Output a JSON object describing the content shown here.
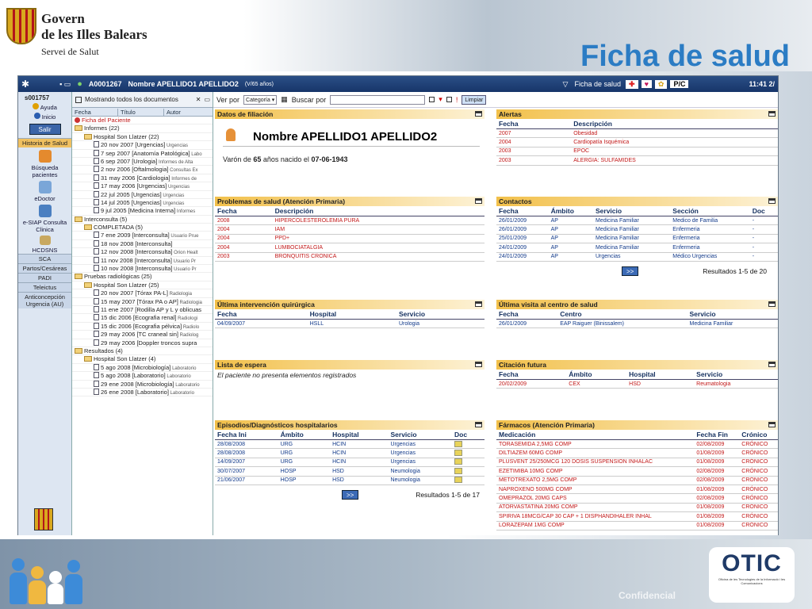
{
  "slide": {
    "org_line1": "Govern",
    "org_line2": "de les Illes Balears",
    "org_line3": "Servei de Salut",
    "title": "Ficha de salud",
    "confidential": "Confidencial",
    "otic_logo": "OTIC",
    "otic_caption": "Oficina de les Tecnologies de la Informació i les Comunicacions"
  },
  "appbar": {
    "patient_id": "A0001267",
    "patient_name": "Nombre APELLIDO1 APELLIDO2",
    "age": "(V/65 años)",
    "section": "Ficha de salud",
    "badge_pc": "P/C",
    "clock": "11:41 2/"
  },
  "leftnav": {
    "user": "s001757",
    "help": "Ayuda",
    "home": "Inicio",
    "exit": "Salir",
    "active_tab": "Historia de Salud",
    "tools": [
      "Búsqueda pacientes",
      "eDoctor",
      "e-SIAP Consulta Clinica",
      "HCDSNS"
    ],
    "tabs": [
      "SCA",
      "Partos/Cesáreas",
      "PADI",
      "Teleictus",
      "Anticoncepción Urgencia (AU)"
    ]
  },
  "tree": {
    "showing": "Mostrando todos los documentos",
    "columns": [
      "Fecha",
      "Título",
      "Autor"
    ],
    "rows": [
      {
        "indent": 0,
        "kind": "red",
        "text": "Ficha del Paciente",
        "sub": ""
      },
      {
        "indent": 0,
        "kind": "folder",
        "text": "Informes  (22)",
        "sub": ""
      },
      {
        "indent": 1,
        "kind": "folder",
        "text": "Hospital Son Llatzer  (22)",
        "sub": ""
      },
      {
        "indent": 2,
        "kind": "doc",
        "text": "20 nov 2007 [Urgencias]",
        "sub": "Urgencias"
      },
      {
        "indent": 2,
        "kind": "doc",
        "text": "7 sep 2007 [Anatomía Patológica]",
        "sub": "Labo"
      },
      {
        "indent": 2,
        "kind": "doc",
        "text": "6 sep 2007 [Urologia]",
        "sub": "Informes de Alta"
      },
      {
        "indent": 2,
        "kind": "doc",
        "text": "2 nov 2006 [Oftalmologia]",
        "sub": "Consultas Ex"
      },
      {
        "indent": 2,
        "kind": "doc",
        "text": "31 may 2006 [Cardiologia]",
        "sub": "Informes de"
      },
      {
        "indent": 2,
        "kind": "doc",
        "text": "17 may 2006 [Urgencias]",
        "sub": "Urgencias"
      },
      {
        "indent": 2,
        "kind": "doc",
        "text": "22 jul 2005 [Urgencias]",
        "sub": "Urgencias"
      },
      {
        "indent": 2,
        "kind": "doc",
        "text": "14 jul 2005 [Urgencias]",
        "sub": "Urgencias"
      },
      {
        "indent": 2,
        "kind": "doc",
        "text": "9 jul 2005 [Medicina Interna]",
        "sub": "Informes"
      },
      {
        "indent": 0,
        "kind": "folder",
        "text": "Interconsulta  (5)",
        "sub": ""
      },
      {
        "indent": 1,
        "kind": "folder",
        "text": "COMPLETADA  (5)",
        "sub": ""
      },
      {
        "indent": 2,
        "kind": "doc",
        "text": "7 ene 2009 [Interconsulta]",
        "sub": "Usuario Prue"
      },
      {
        "indent": 2,
        "kind": "doc",
        "text": "18 nov 2008 [Interconsulta]",
        "sub": ""
      },
      {
        "indent": 2,
        "kind": "doc",
        "text": "12 nov 2008 [Interconsulta]",
        "sub": "Orion Healt"
      },
      {
        "indent": 2,
        "kind": "doc",
        "text": "11 nov 2008 [Interconsulta]",
        "sub": "Usuario Pr"
      },
      {
        "indent": 2,
        "kind": "doc",
        "text": "10 nov 2008 [Interconsulta]",
        "sub": "Usuario Pr"
      },
      {
        "indent": 0,
        "kind": "folder",
        "text": "Pruebas radiológicas  (25)",
        "sub": ""
      },
      {
        "indent": 1,
        "kind": "folder",
        "text": "Hospital Son Llatzer  (25)",
        "sub": ""
      },
      {
        "indent": 2,
        "kind": "doc",
        "text": "20 nov 2007 [Tórax PA-L]",
        "sub": "Radiologia"
      },
      {
        "indent": 2,
        "kind": "doc",
        "text": "15 may 2007 [Tórax PA o AP]",
        "sub": "Radiologia"
      },
      {
        "indent": 2,
        "kind": "doc",
        "text": "11 ene 2007 [Rodilla AP y L y oblicuas",
        "sub": ""
      },
      {
        "indent": 2,
        "kind": "doc",
        "text": "15 dic 2006 [Ecografia renal]",
        "sub": "Radiologi"
      },
      {
        "indent": 2,
        "kind": "doc",
        "text": "15 dic 2006 [Ecografia pélvica]",
        "sub": "Radiolo"
      },
      {
        "indent": 2,
        "kind": "doc",
        "text": "29 may 2006 [TC craneal sin]",
        "sub": "Radiolog"
      },
      {
        "indent": 2,
        "kind": "doc",
        "text": "29 may 2006 [Doppler troncos supra",
        "sub": ""
      },
      {
        "indent": 0,
        "kind": "folder",
        "text": "Resultados  (4)",
        "sub": ""
      },
      {
        "indent": 1,
        "kind": "folder",
        "text": "Hospital Son Llatzer  (4)",
        "sub": ""
      },
      {
        "indent": 2,
        "kind": "doc",
        "text": "5 ago 2008 [Microbiología]",
        "sub": "Laboratorio"
      },
      {
        "indent": 2,
        "kind": "doc",
        "text": "5 ago 2008 [Laboratorio]",
        "sub": "Laboratorio"
      },
      {
        "indent": 2,
        "kind": "doc",
        "text": "29 ene 2008 [Microbiología]",
        "sub": "Laboratorio"
      },
      {
        "indent": 2,
        "kind": "doc",
        "text": "26 ene 2008 [Laboratorio]",
        "sub": "Laboratorio"
      }
    ]
  },
  "filter": {
    "view_label": "Ver por",
    "view_value": "Categoría",
    "search_label": "Buscar por",
    "clear": "Limpiar"
  },
  "filiacion": {
    "title": "Datos de filiación",
    "name": "Nombre APELLIDO1 APELLIDO2",
    "desc_pre": "Varón de ",
    "desc_age": "65",
    "desc_mid": " años nacido el ",
    "desc_date": "07-06-1943"
  },
  "alertas": {
    "title": "Alertas",
    "columns": [
      "Fecha",
      "Descripción"
    ],
    "rows": [
      [
        "2007",
        "Obesidad"
      ],
      [
        "2004",
        "Cardiopatía Isquémica"
      ],
      [
        "2003",
        "EPOC"
      ],
      [
        "2003",
        "ALERGIA: SULFAMIDES"
      ]
    ]
  },
  "problemas": {
    "title": "Problemas de salud (Atención Primaria)",
    "columns": [
      "Fecha",
      "Descripción"
    ],
    "rows": [
      [
        "2008",
        "HIPERCOLESTEROLEMIA PURA"
      ],
      [
        "2004",
        "IAM"
      ],
      [
        "2004",
        "PPD+"
      ],
      [
        "2004",
        "LUMBOCIATALGIA"
      ],
      [
        "2003",
        "BRONQUITIS CRONICA"
      ]
    ]
  },
  "contactos": {
    "title": "Contactos",
    "columns": [
      "Fecha",
      "Ámbito",
      "Servicio",
      "Sección",
      "Doc"
    ],
    "rows": [
      [
        "26/01/2009",
        "AP",
        "Medicina Familiar",
        "Medico de Familia",
        "-"
      ],
      [
        "26/01/2009",
        "AP",
        "Medicina Familiar",
        "Enfermeria",
        "-"
      ],
      [
        "25/01/2009",
        "AP",
        "Medicina Familiar",
        "Enfermeria",
        "-"
      ],
      [
        "24/01/2009",
        "AP",
        "Medicina Familiar",
        "Enfermeria",
        "-"
      ],
      [
        "24/01/2009",
        "AP",
        "Urgencias",
        "Médico Urgencias",
        "-"
      ]
    ],
    "next": ">>",
    "results": "Resultados 1-5 de 20"
  },
  "quirurgica": {
    "title": "Última intervención quirúrgica",
    "columns": [
      "Fecha",
      "Hospital",
      "Servicio"
    ],
    "rows": [
      [
        "04/09/2007",
        "HSLL",
        "Urologia"
      ]
    ]
  },
  "visita": {
    "title": "Última visita al centro de salud",
    "columns": [
      "Fecha",
      "Centro",
      "Servicio"
    ],
    "rows": [
      [
        "26/01/2009",
        "EAP Raiguer (Binissalem)",
        "Medicina Familiar"
      ]
    ]
  },
  "espera": {
    "title": "Lista de espera",
    "message": "El paciente no presenta elementos registrados"
  },
  "citacion": {
    "title": "Citación futura",
    "columns": [
      "Fecha",
      "Ámbito",
      "Hospital",
      "Servicio"
    ],
    "rows": [
      [
        "20/02/2009",
        "CEX",
        "HSD",
        "Reumatologia"
      ]
    ]
  },
  "episodios": {
    "title": "Episodios/Diagnósticos hospitalarios",
    "columns": [
      "Fecha Ini",
      "Ámbito",
      "Hospital",
      "Servicio",
      "Doc"
    ],
    "rows": [
      [
        "28/08/2008",
        "URG",
        "HCIN",
        "Urgencias"
      ],
      [
        "28/08/2008",
        "URG",
        "HCIN",
        "Urgencias"
      ],
      [
        "14/09/2007",
        "URG",
        "HCIN",
        "Urgencias"
      ],
      [
        "30/07/2007",
        "HOSP",
        "HSD",
        "Neumologia"
      ],
      [
        "21/06/2007",
        "HOSP",
        "HSD",
        "Neumologia"
      ]
    ],
    "next": ">>",
    "results": "Resultados 1-5 de 17"
  },
  "farmacos": {
    "title": "Fármacos (Atención Primaria)",
    "columns": [
      "Medicación",
      "Fecha Fin",
      "Crónico"
    ],
    "rows": [
      [
        "TORASEMIDA 2,5MG COMP",
        "02/08/2009",
        "CRÓNICO"
      ],
      [
        "DILTIAZEM 60MG COMP",
        "01/08/2009",
        "CRÓNICO"
      ],
      [
        "PLUSVENT 25/250MCG 120 DOSIS SUSPENSION INHALAC",
        "01/08/2009",
        "CRÓNICO"
      ],
      [
        "EZETIMIBA 10MG COMP",
        "02/08/2009",
        "CRÓNICO"
      ],
      [
        "METOTREXATO 2,5MG COMP",
        "02/08/2009",
        "CRÓNICO"
      ],
      [
        "NAPROXENO 500MG COMP",
        "01/08/2009",
        "CRÓNICO"
      ],
      [
        "OMEPRAZOL 20MG CAPS",
        "02/08/2009",
        "CRÓNICO"
      ],
      [
        "ATORVASTATINA 20MG COMP",
        "01/08/2009",
        "CRÓNICO"
      ],
      [
        "SPIRIVA 18MCG/CAP 30 CAP + 1 DISPHANDIHALER INHAL",
        "01/08/2009",
        "CRÓNICO"
      ],
      [
        "LORAZEPAM 1MG COMP",
        "01/08/2009",
        "CRÓNICO"
      ]
    ]
  }
}
